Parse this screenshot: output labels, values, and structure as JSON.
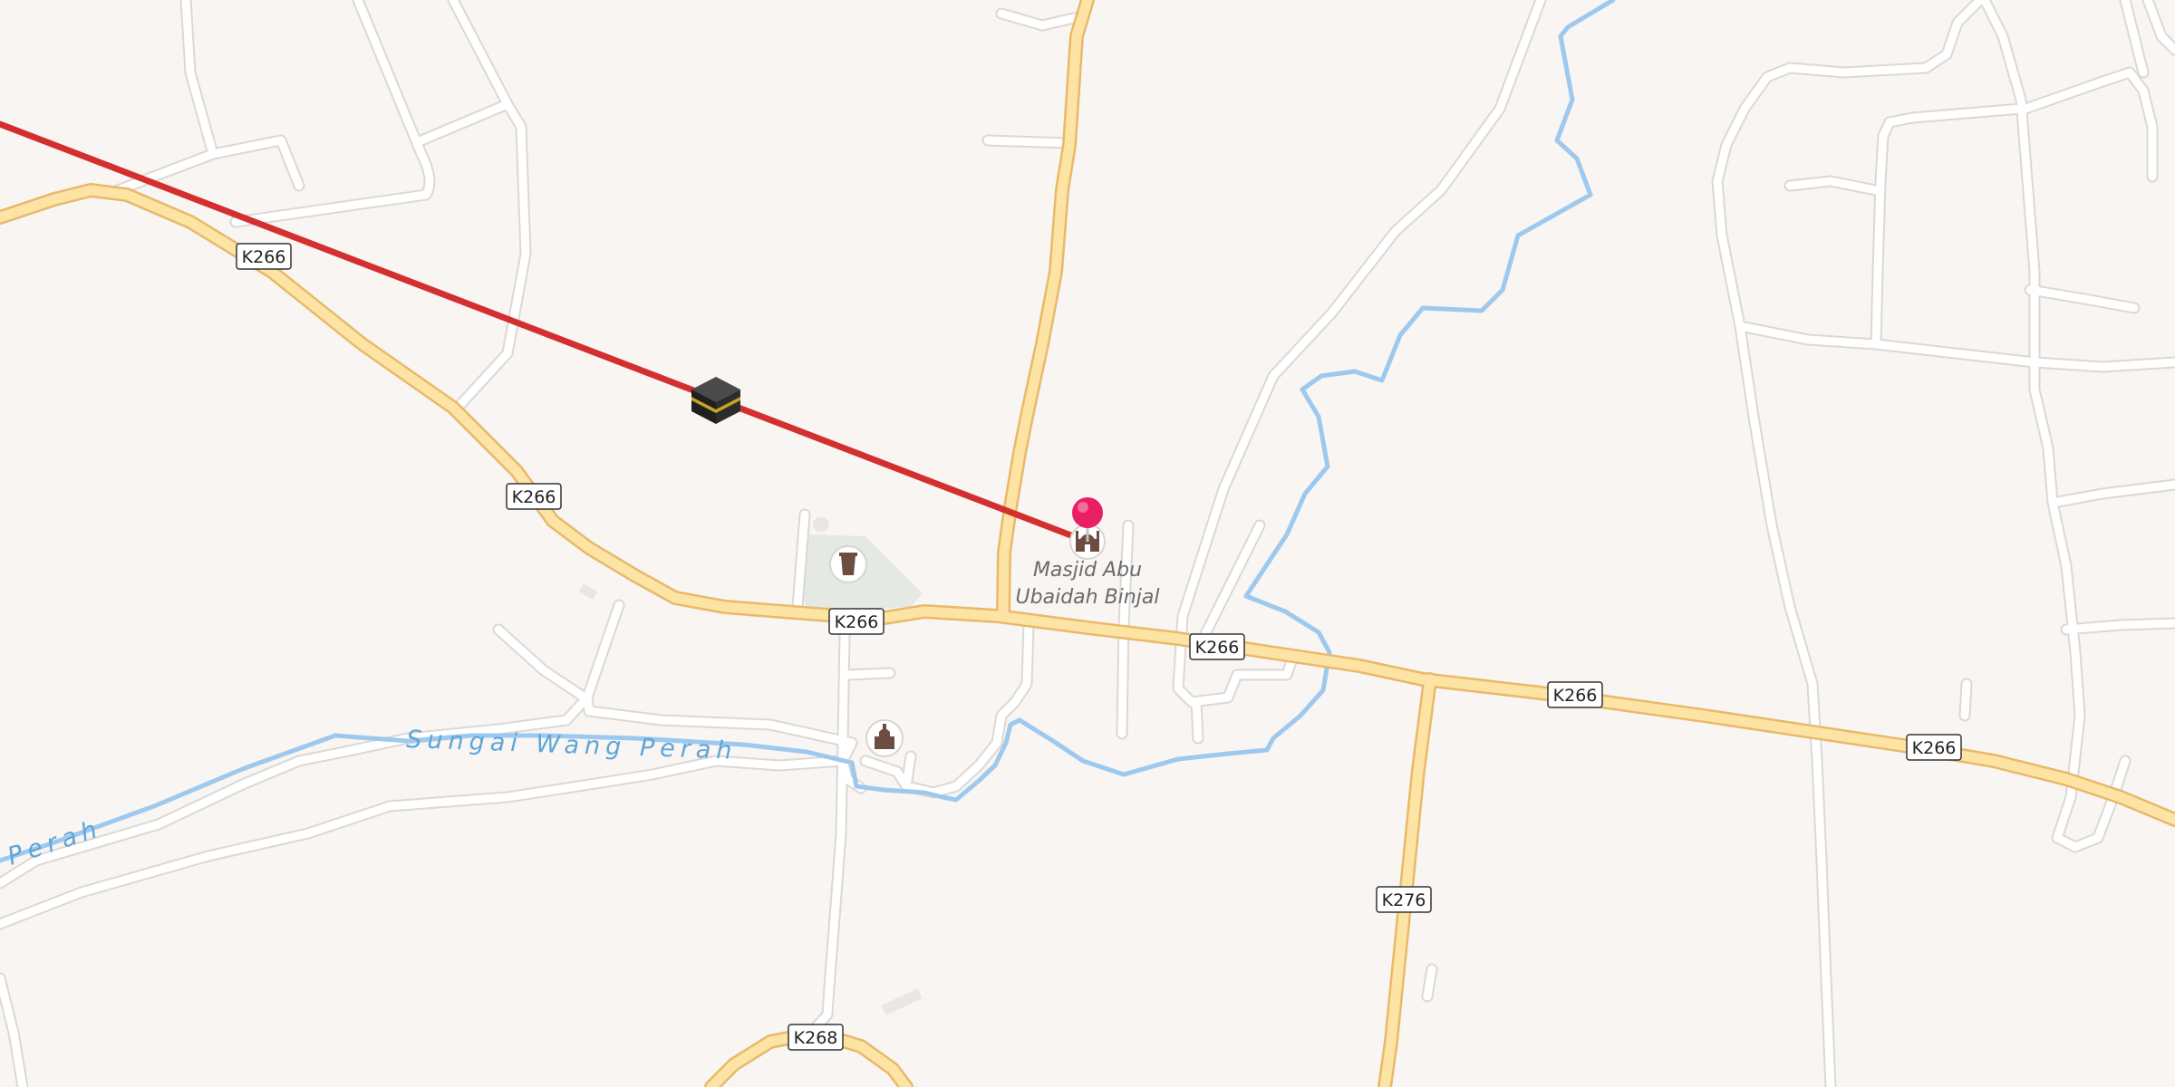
{
  "map": {
    "place": {
      "name_line1": "Masjid Abu",
      "name_line2": "Ubaidah Binjal"
    },
    "river": {
      "name": "Sungai Wang Perah",
      "name_fragment": "Perah"
    },
    "road_labels": {
      "k266_a": "K266",
      "k266_b": "K266",
      "k266_c": "K266",
      "k266_d": "K266",
      "k266_e": "K266",
      "k266_f": "K266",
      "k276": "K276",
      "k268": "K268"
    },
    "icons": {
      "kaaba": "kaaba-icon",
      "place_marker": "map-pin-icon",
      "mosque": "mosque-icon",
      "cemetery": "cemetery-icon",
      "place_of_worship": "place-of-worship-icon"
    },
    "colors": {
      "background": "#f8f5f2",
      "major_road_fill": "#fde4a5",
      "major_road_casing": "#e8b96a",
      "minor_road": "#ffffff",
      "minor_road_casing": "#dcd8d4",
      "water": "#9ec9ee",
      "qibla_line": "#d32f2f",
      "marker": "#e91e63",
      "green_area": "#e4e9e3"
    }
  }
}
